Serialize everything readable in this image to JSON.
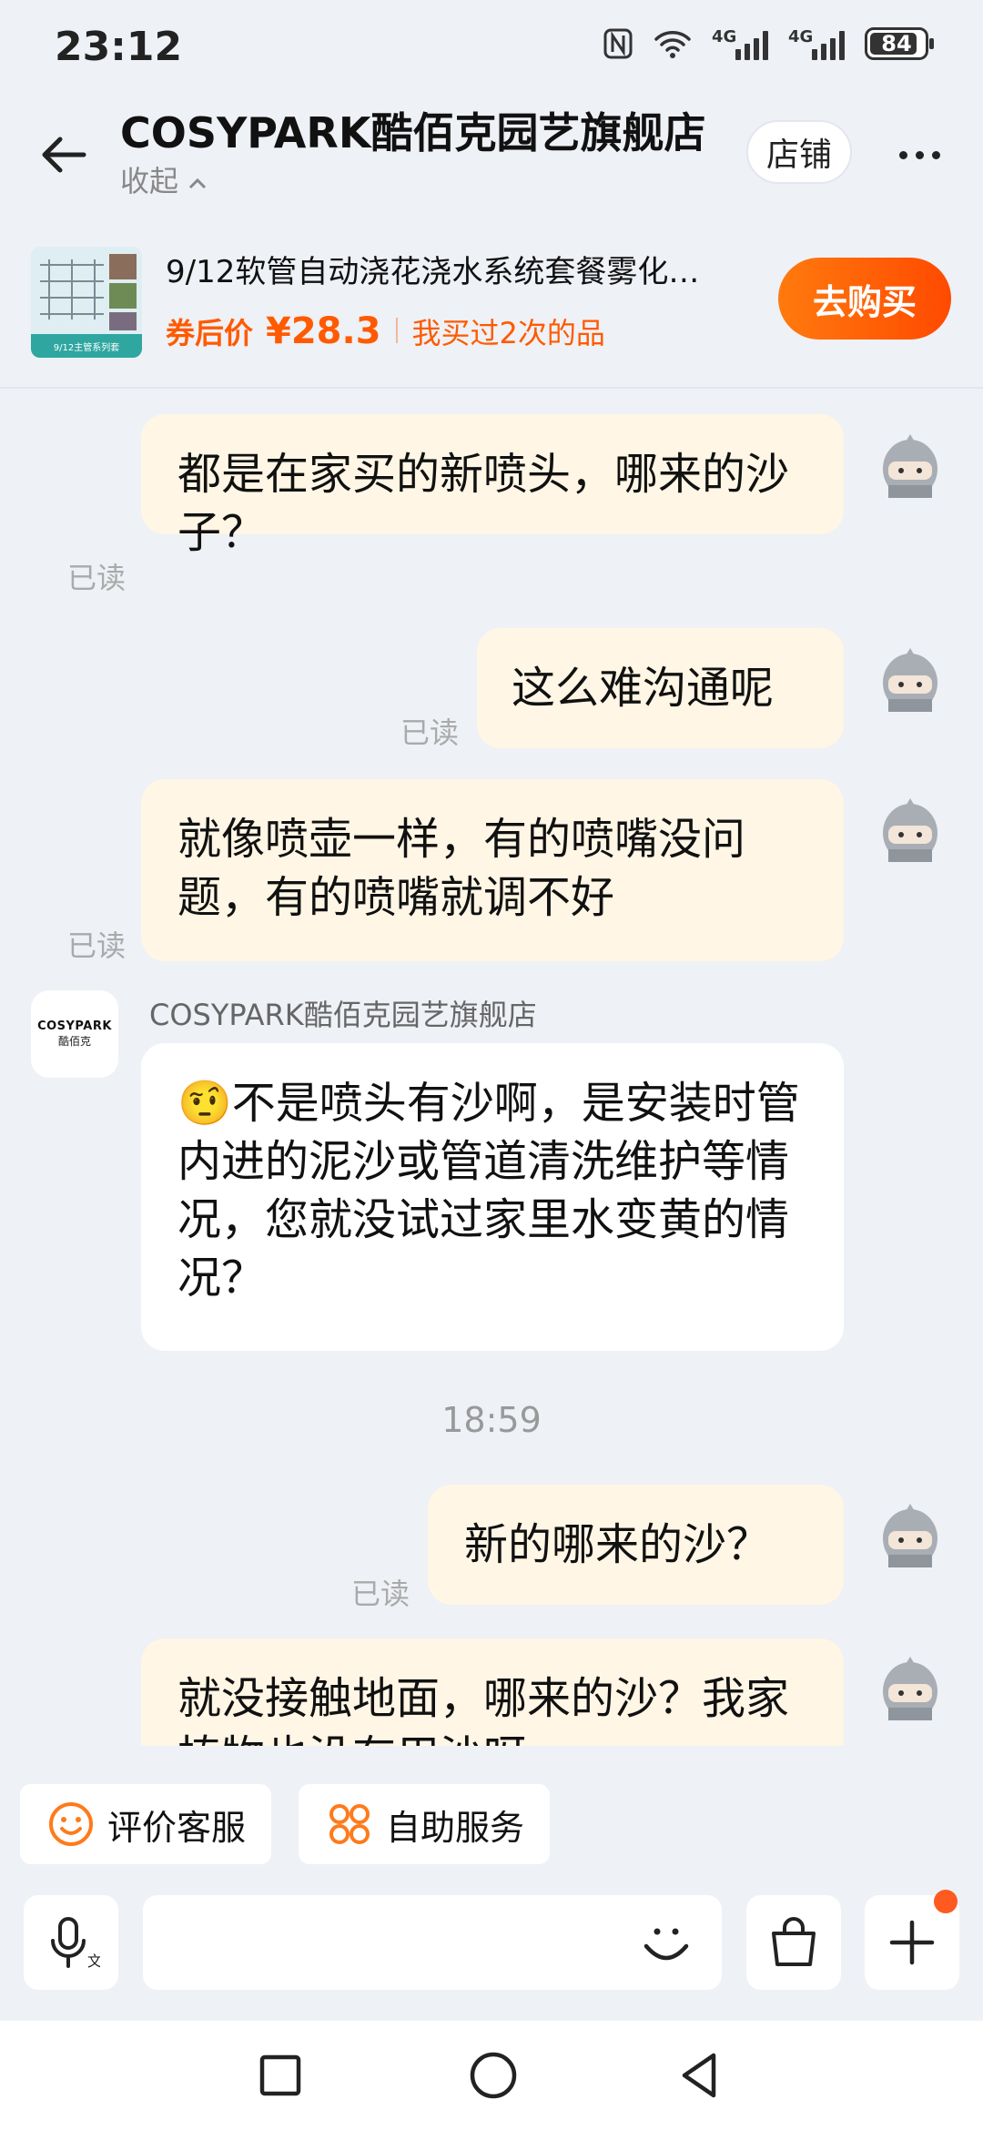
{
  "status": {
    "time": "23:12",
    "net1": "4G",
    "net2": "4G",
    "battery": "84"
  },
  "header": {
    "title": "COSYPARK酷佰克园艺旗舰店",
    "collapse": "收起",
    "shop_label": "店铺"
  },
  "product": {
    "title": "9/12软管自动浇花浇水系统套餐雾化…",
    "price_label": "券后价",
    "price": "¥28.3",
    "bought_text": "我买过2次的品",
    "buy_label": "去购买",
    "thumb_caption": "9/12主管系列套"
  },
  "messages": [
    {
      "side": "out",
      "text": "都是在家买的新喷头，哪来的沙子？",
      "status": "已读"
    },
    {
      "side": "out",
      "text": "这么难沟通呢",
      "status": "已读"
    },
    {
      "side": "out",
      "text": "就像喷壶一样，有的喷嘴没问题，有的喷嘴就调不好",
      "status": "已读"
    },
    {
      "side": "in",
      "sender": "COSYPARK酷佰克园艺旗舰店",
      "emoji": "🤨",
      "text": "不是喷头有沙啊，是安装时管内进的泥沙或管道清洗维护等情况，您就没试过家里水变黄的情况？"
    },
    {
      "time": "18:59"
    },
    {
      "side": "out",
      "text": "新的哪来的沙？",
      "status": "已读"
    },
    {
      "side": "out",
      "text": "就没接触地面，哪来的沙？我家植物也没有用沙呀"
    }
  ],
  "store_avatar": {
    "brand": "COSYPARK",
    "sub": "酷佰克"
  },
  "quick_actions": [
    {
      "label": "评价客服",
      "icon": "smile-icon"
    },
    {
      "label": "自助服务",
      "icon": "grid-icon"
    }
  ],
  "input": {
    "placeholder": ""
  },
  "colors": {
    "accent": "#ff5a00",
    "bubble_out": "#fff6e5",
    "background": "#eef1f6"
  }
}
